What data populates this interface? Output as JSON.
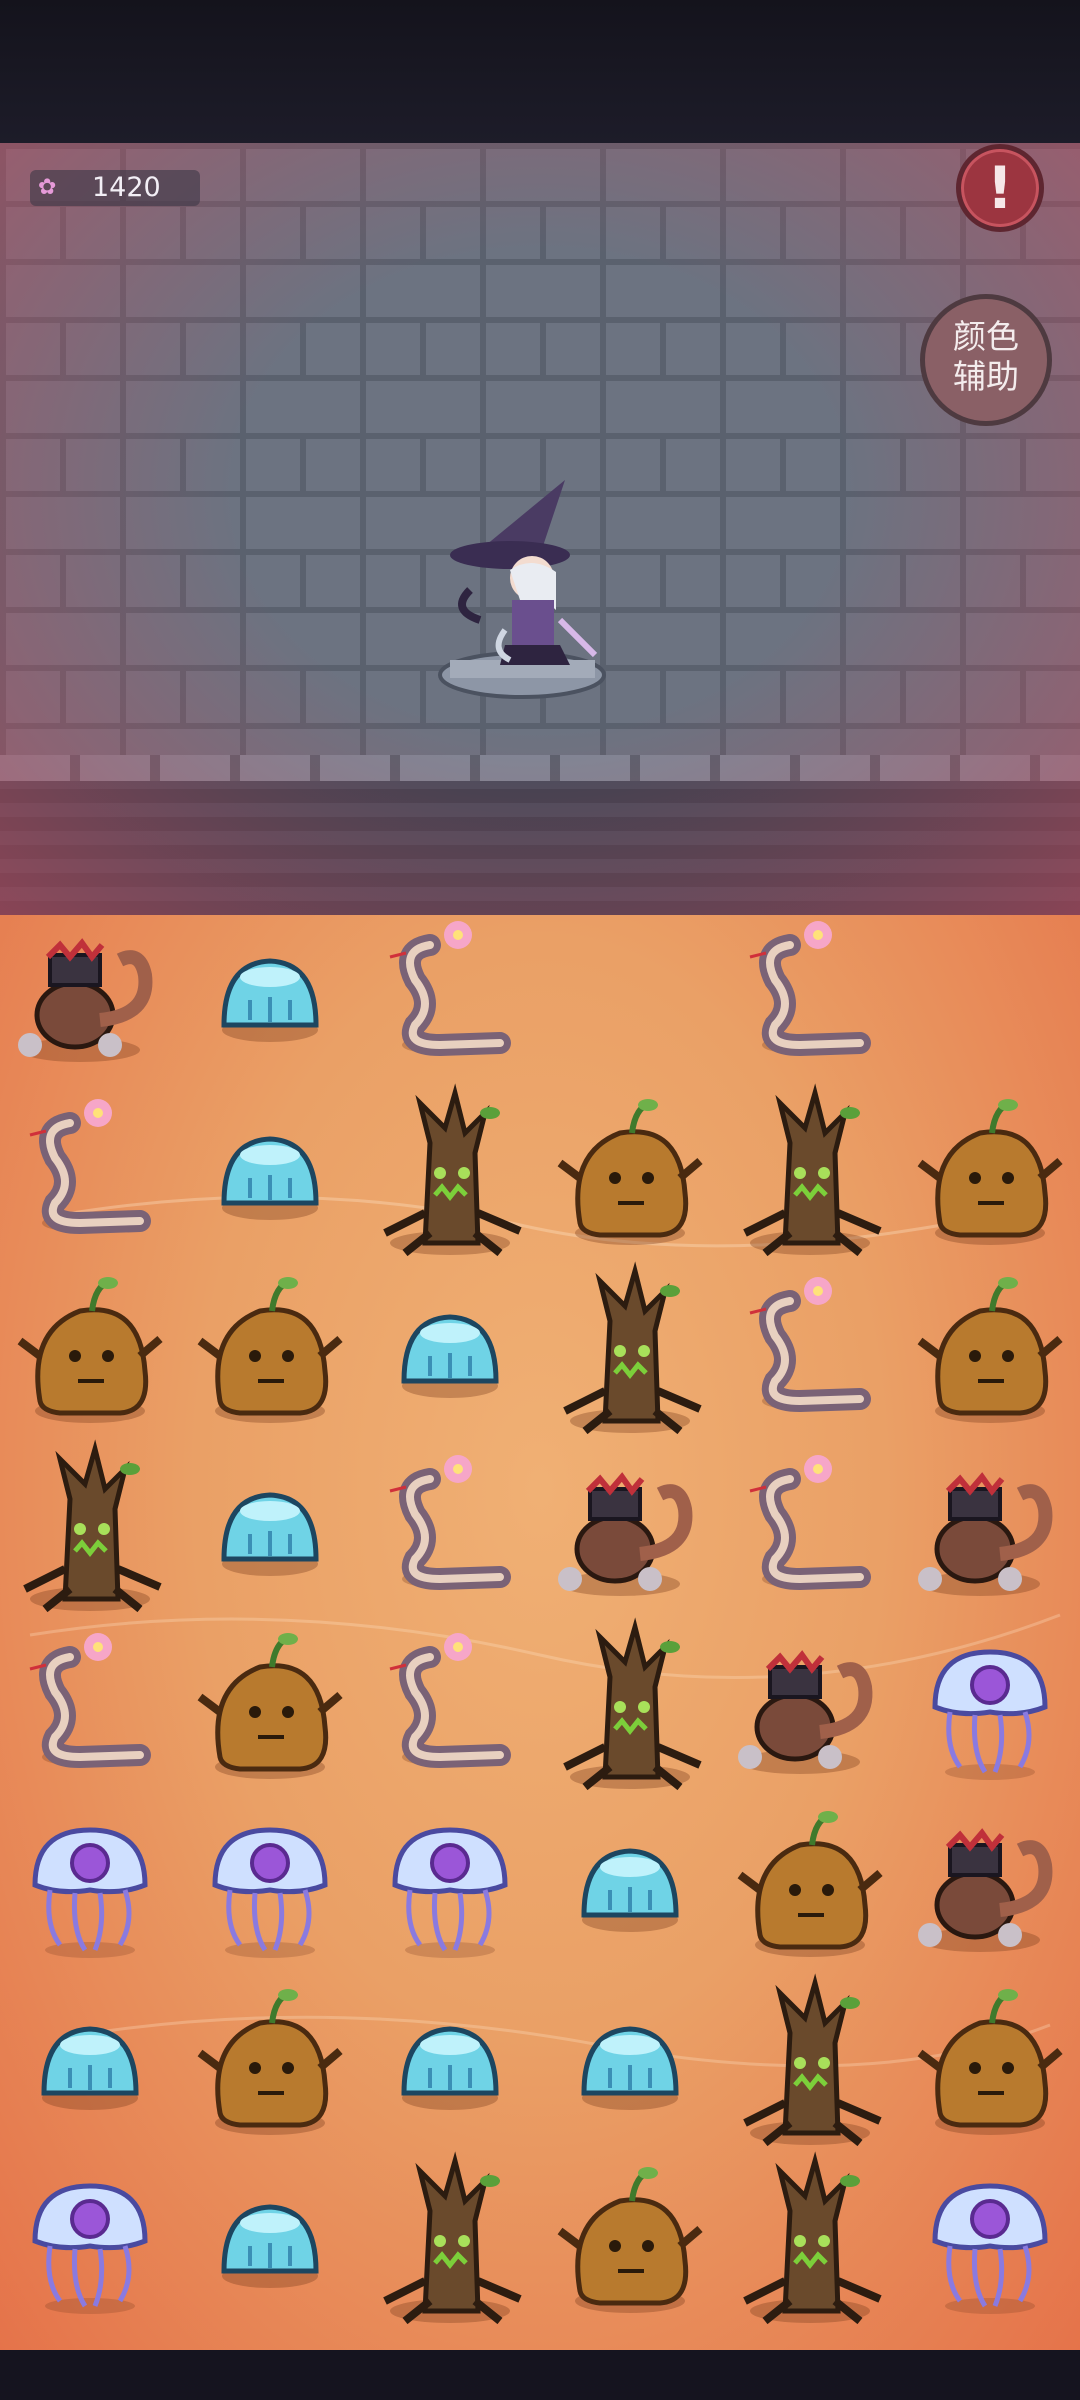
{
  "score": {
    "value": "1420",
    "icon": "flower-icon"
  },
  "buttons": {
    "alert_label": "!",
    "color_assist_line1": "颜色",
    "color_assist_line2": "辅助"
  },
  "board": {
    "rows": 8,
    "cols": 6,
    "grid": [
      [
        "scorpion",
        "slime",
        "snake",
        "empty",
        "snake",
        "empty"
      ],
      [
        "snake",
        "slime",
        "tree",
        "potato",
        "tree",
        "potato"
      ],
      [
        "potato",
        "potato",
        "slime",
        "tree",
        "snake",
        "potato"
      ],
      [
        "tree",
        "slime",
        "snake",
        "scorpion",
        "snake",
        "scorpion"
      ],
      [
        "snake",
        "potato",
        "snake",
        "tree",
        "scorpion",
        "jellyfish"
      ],
      [
        "jellyfish",
        "jellyfish",
        "jellyfish",
        "slime",
        "potato",
        "scorpion"
      ],
      [
        "slime",
        "potato",
        "slime",
        "slime",
        "tree",
        "potato"
      ],
      [
        "jellyfish",
        "slime",
        "tree",
        "potato",
        "tree",
        "jellyfish"
      ]
    ]
  },
  "colors": {
    "board_light": "#f0b074",
    "board_dark": "#e5734a",
    "wall": "#6c7381",
    "alert": "#9c3540",
    "slime": "#6fd3e6",
    "potato": "#b87a2e",
    "tree": "#6a4a2c",
    "snake": "#7a6276",
    "scorpion": "#7a4a3a",
    "jellyfish": "#cfe0ff"
  }
}
